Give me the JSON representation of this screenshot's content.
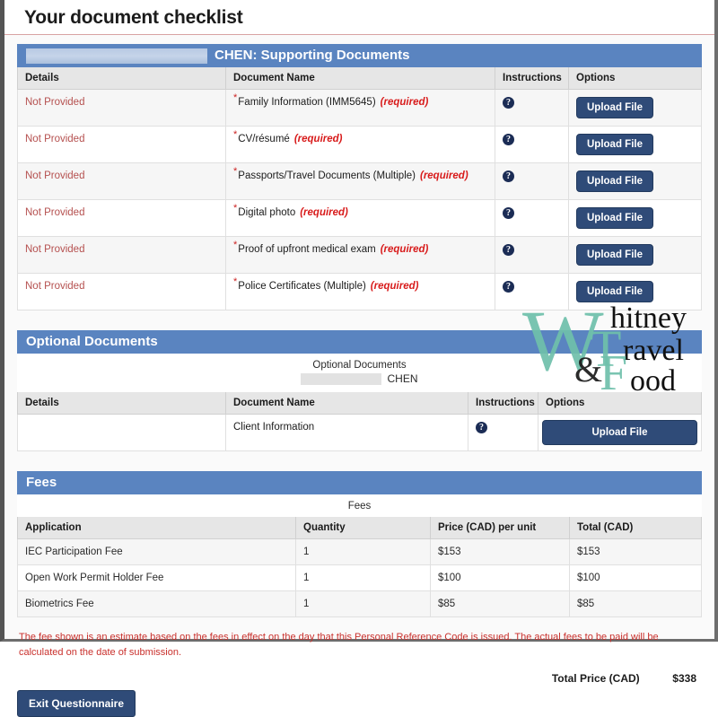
{
  "page": {
    "title": "Your document checklist"
  },
  "supporting": {
    "header_label": "CHEN: Supporting Documents",
    "redacted_name": "",
    "columns": [
      "Details",
      "Document Name",
      "Instructions",
      "Options"
    ],
    "rows": [
      {
        "details": "Not Provided",
        "name": "Family Information (IMM5645)",
        "required": "(required)",
        "instructions": "?",
        "option": "Upload File"
      },
      {
        "details": "Not Provided",
        "name": "CV/résumé",
        "required": "(required)",
        "instructions": "?",
        "option": "Upload File"
      },
      {
        "details": "Not Provided",
        "name": "Passports/Travel Documents (Multiple)",
        "required": "(required)",
        "instructions": "?",
        "option": "Upload File"
      },
      {
        "details": "Not Provided",
        "name": "Digital photo",
        "required": "(required)",
        "instructions": "?",
        "option": "Upload File"
      },
      {
        "details": "Not Provided",
        "name": "Proof of upfront medical exam",
        "required": "(required)",
        "instructions": "?",
        "option": "Upload File"
      },
      {
        "details": "Not Provided",
        "name": "Police Certificates (Multiple)",
        "required": "(required)",
        "instructions": "?",
        "option": "Upload File"
      }
    ]
  },
  "optional": {
    "header_label": "Optional Documents",
    "caption": "Optional Documents",
    "caption_name": "CHEN",
    "columns": [
      "Details",
      "Document Name",
      "Instructions",
      "Options"
    ],
    "rows": [
      {
        "details": "",
        "name": "Client Information",
        "instructions": "?",
        "option": "Upload File"
      }
    ]
  },
  "fees": {
    "header_label": "Fees",
    "caption": "Fees",
    "columns": [
      "Application",
      "Quantity",
      "Price (CAD) per unit",
      "Total (CAD)"
    ],
    "rows": [
      {
        "application": "IEC Participation Fee",
        "quantity": "1",
        "price": "$153",
        "total": "$153"
      },
      {
        "application": "Open Work Permit Holder Fee",
        "quantity": "1",
        "price": "$100",
        "total": "$100"
      },
      {
        "application": "Biometrics Fee",
        "quantity": "1",
        "price": "$85",
        "total": "$85"
      }
    ],
    "disclaimer": "The fee shown is an estimate based on the fees in effect on the day that this Personal Reference Code is issued. The actual fees to be paid will be calculated on the date of submission.",
    "total_label": "Total Price (CAD)",
    "total_amount": "$338"
  },
  "footer": {
    "exit_label": "Exit Questionnaire"
  },
  "watermark": {
    "w": "W",
    "hitney": "hitney",
    "t": "T",
    "ravel": "ravel",
    "amp": "&",
    "f": "F",
    "ood": "ood"
  },
  "colors": {
    "section_header_blue": "#5a84c0",
    "button_navy": "#2f4b78",
    "required_red": "#d81b1b",
    "not_provided_red": "#b5504f",
    "watermark_teal": "#6fc0ab"
  }
}
